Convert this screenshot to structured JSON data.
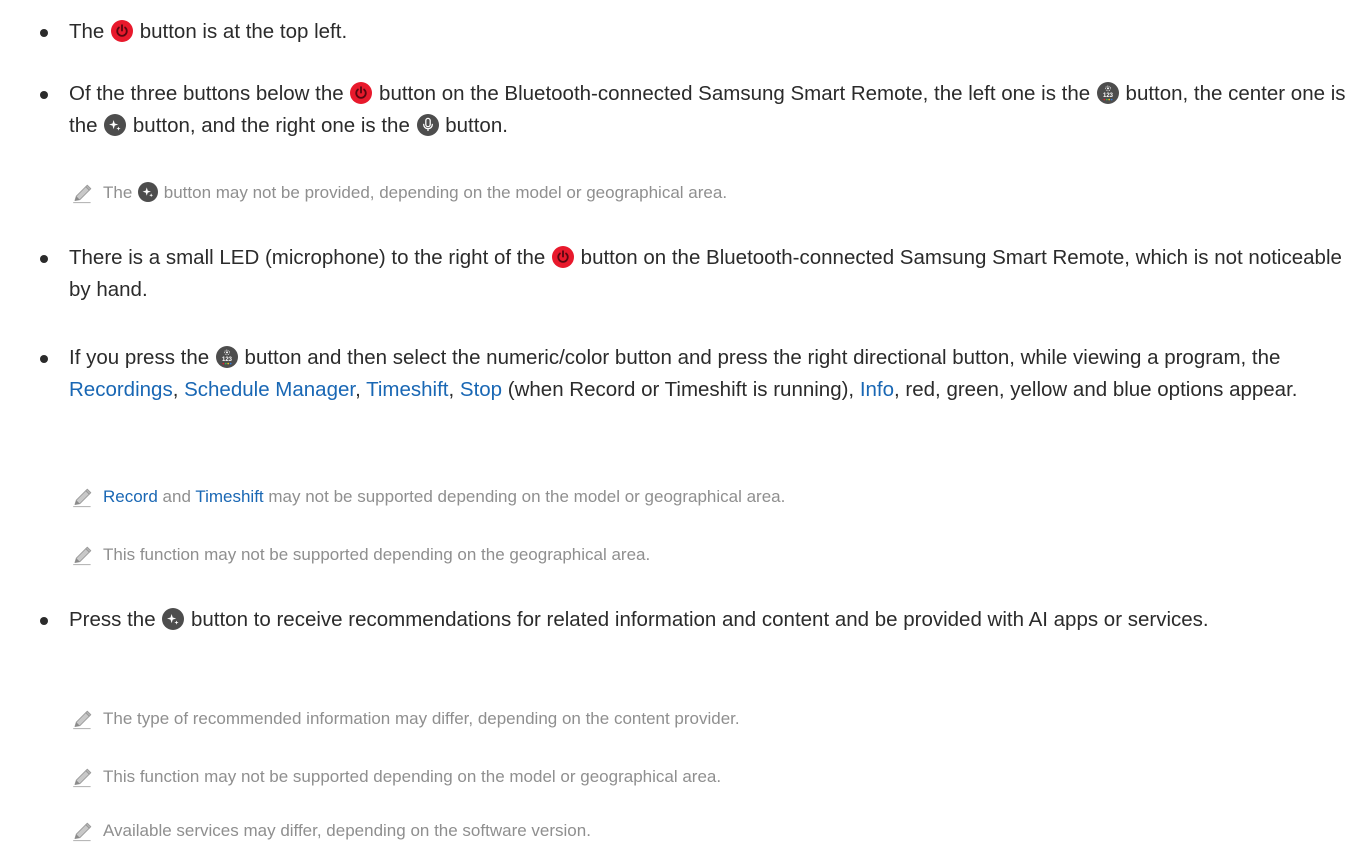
{
  "bullets": [
    {
      "parts": {
        "a": "The ",
        "b": " button is at the top left."
      }
    },
    {
      "parts": {
        "a": "Of the three buttons below the ",
        "b": " button on the Bluetooth-connected Samsung Smart Remote, the left one is the ",
        "c": " button, the center one is the ",
        "d": " button, and the right one is the ",
        "e": " button."
      }
    },
    {
      "parts": {
        "a": "There is a small LED (microphone) to the right of the ",
        "b": " button on the Bluetooth-connected Samsung Smart Remote, which is not noticeable by hand."
      }
    },
    {
      "parts": {
        "a": "If you press the ",
        "b": " button and then select the numeric/color button and press the right directional button, while viewing a program, the ",
        "recordings": "Recordings",
        "c": ", ",
        "schedule_manager": "Schedule Manager",
        "d": ", ",
        "timeshift": "Timeshift",
        "e": ", ",
        "stop": "Stop",
        "f": " (when Record or Timeshift is running), ",
        "info": "Info",
        "g": ", red, green, yellow and blue options appear."
      }
    },
    {
      "parts": {
        "a": "Press the ",
        "b": " button to receive recommendations for related information and content and be provided with AI apps or services."
      }
    }
  ],
  "notes": [
    {
      "parts": {
        "a": "The ",
        "b": " button may not be provided, depending on the model or geographical area."
      }
    },
    {
      "parts": {
        "record": "Record",
        "a": " and ",
        "timeshift": "Timeshift",
        "b": " may not be supported depending on the model or geographical area."
      }
    },
    {
      "parts": {
        "a": "This function may not be supported depending on the geographical area."
      }
    },
    {
      "parts": {
        "a": "The type of recommended information may differ, depending on the content provider."
      }
    },
    {
      "parts": {
        "a": "This function may not be supported depending on the model or geographical area."
      }
    },
    {
      "parts": {
        "a": "Available services may differ, depending on the software version."
      }
    }
  ],
  "icons": {
    "power": "power-button-icon",
    "numeric": "numeric-123-button-icon",
    "ai": "ai-button-icon",
    "mic": "microphone-button-icon",
    "note": "pencil-note-icon"
  },
  "colors": {
    "body_text": "#2b2b2b",
    "note_text": "#8f8f8f",
    "term_blue": "#1967b4",
    "power_red": "#e8192c",
    "icon_gray": "#4d4d4d"
  }
}
